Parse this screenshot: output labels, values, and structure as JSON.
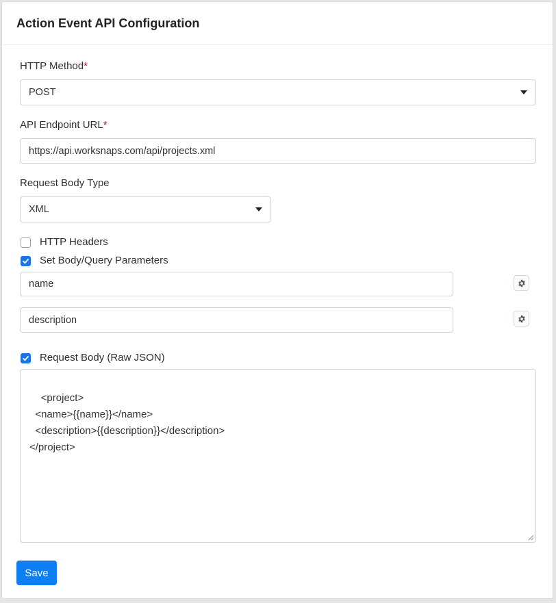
{
  "header": {
    "title": "Action Event API Configuration"
  },
  "form": {
    "http_method": {
      "label": "HTTP Method",
      "required_mark": "*",
      "value": "POST"
    },
    "endpoint": {
      "label": "API Endpoint URL",
      "required_mark": "*",
      "value": "https://api.worksnaps.com/api/projects.xml"
    },
    "body_type": {
      "label": "Request Body Type",
      "value": "XML"
    },
    "http_headers": {
      "label": "HTTP Headers",
      "checked": false
    },
    "body_params": {
      "label": "Set Body/Query Parameters",
      "checked": true,
      "params": [
        {
          "value": "name"
        },
        {
          "value": "description"
        }
      ]
    },
    "raw_body": {
      "label": "Request Body (Raw JSON)",
      "checked": true,
      "value": "<project>\n  <name>{{name}}</name>\n  <description>{{description}}</description>\n</project>"
    },
    "save_label": "Save"
  },
  "colors": {
    "accent": "#0d7ff2",
    "checkbox": "#1a73e8",
    "required": "#d0021b"
  },
  "icons": {
    "param_settings": "gear-icon",
    "select_arrow": "caret-down-icon"
  }
}
